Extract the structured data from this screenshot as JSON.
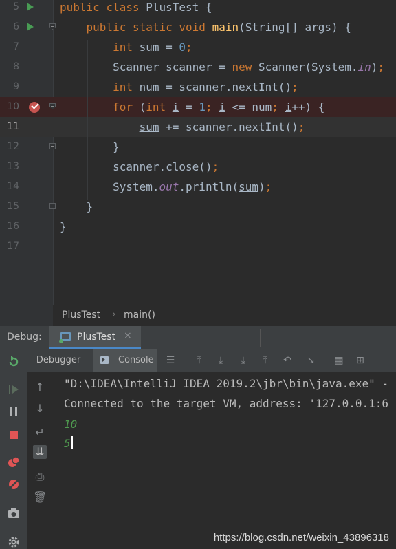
{
  "editor": {
    "lines": [
      {
        "num": "5",
        "tokens": [
          [
            "kw",
            "public "
          ],
          [
            "kw",
            "class "
          ],
          [
            "txt",
            "PlusTest {"
          ]
        ]
      },
      {
        "num": "6",
        "tokens": [
          [
            "txt",
            "    "
          ],
          [
            "kw",
            "public "
          ],
          [
            "kw",
            "static "
          ],
          [
            "kw",
            "void "
          ],
          [
            "fn",
            "main"
          ],
          [
            "txt",
            "(String[] args) {"
          ]
        ]
      },
      {
        "num": "7",
        "tokens": [
          [
            "txt",
            "        "
          ],
          [
            "kw",
            "int "
          ],
          [
            "ul",
            "sum"
          ],
          [
            "txt",
            " = "
          ],
          [
            "num",
            "0"
          ],
          [
            "kw",
            ";"
          ]
        ]
      },
      {
        "num": "8",
        "tokens": [
          [
            "txt",
            "        Scanner scanner = "
          ],
          [
            "kw",
            "new "
          ],
          [
            "txt",
            "Scanner(System."
          ],
          [
            "fld",
            "in"
          ],
          [
            "txt",
            ")"
          ],
          [
            "kw",
            ";"
          ]
        ]
      },
      {
        "num": "9",
        "tokens": [
          [
            "txt",
            "        "
          ],
          [
            "kw",
            "int "
          ],
          [
            "txt",
            "num = scanner.nextInt()"
          ],
          [
            "kw",
            ";"
          ]
        ]
      },
      {
        "num": "10",
        "tokens": [
          [
            "txt",
            "        "
          ],
          [
            "kw",
            "for "
          ],
          [
            "txt",
            "("
          ],
          [
            "kw",
            "int "
          ],
          [
            "ul",
            "i"
          ],
          [
            "txt",
            " = "
          ],
          [
            "num",
            "1"
          ],
          [
            "kw",
            "; "
          ],
          [
            "ul",
            "i"
          ],
          [
            "txt",
            " <= num"
          ],
          [
            "kw",
            "; "
          ],
          [
            "ul",
            "i"
          ],
          [
            "txt",
            "++) {"
          ]
        ]
      },
      {
        "num": "11",
        "tokens": [
          [
            "txt",
            "            "
          ],
          [
            "ul",
            "sum"
          ],
          [
            "txt",
            " += scanner.nextInt()"
          ],
          [
            "kw",
            ";"
          ]
        ]
      },
      {
        "num": "12",
        "tokens": [
          [
            "txt",
            "        }"
          ]
        ]
      },
      {
        "num": "13",
        "tokens": [
          [
            "txt",
            "        scanner.close()"
          ],
          [
            "kw",
            ";"
          ]
        ]
      },
      {
        "num": "14",
        "tokens": [
          [
            "txt",
            "        System."
          ],
          [
            "fld",
            "out"
          ],
          [
            "txt",
            ".println("
          ],
          [
            "ul",
            "sum"
          ],
          [
            "txt",
            ")"
          ],
          [
            "kw",
            ";"
          ]
        ]
      },
      {
        "num": "15",
        "tokens": [
          [
            "txt",
            "    }"
          ]
        ]
      },
      {
        "num": "16",
        "tokens": [
          [
            "txt",
            "}"
          ]
        ]
      },
      {
        "num": "17",
        "tokens": []
      }
    ],
    "colors": {
      "keyword": "#cc7832",
      "method": "#ffc66d",
      "number": "#6897bb",
      "field": "#9876aa",
      "text": "#a9b7c6",
      "breakpoint": "#c75450",
      "run": "#499c54"
    }
  },
  "breadcrumb": {
    "class_name": "PlusTest",
    "separator": "›",
    "method_name": "main()"
  },
  "debug": {
    "label": "Debug:",
    "tab_label": "PlusTest",
    "tab_close": "×",
    "subtabs": {
      "debugger": "Debugger",
      "console": "Console"
    },
    "console_lines": [
      "\"D:\\IDEA\\IntelliJ IDEA 2019.2\\jbr\\bin\\java.exe\" -",
      "Connected to the target VM, address: '127.0.0.1:6"
    ],
    "user_input": [
      "10",
      "5"
    ]
  },
  "watermark": "https://blog.csdn.net/weixin_43896318"
}
